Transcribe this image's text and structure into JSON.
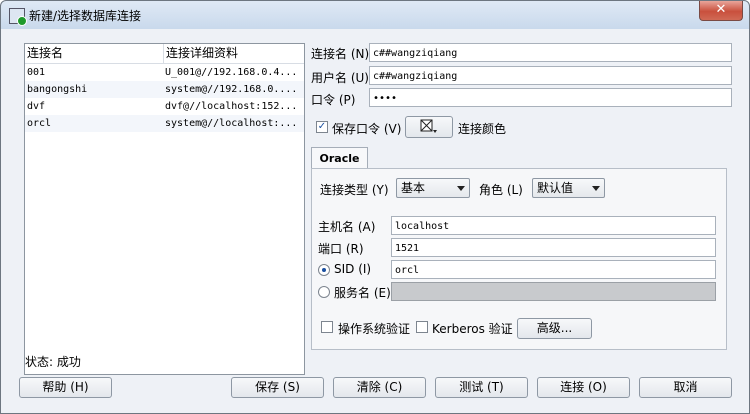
{
  "window": {
    "title": "新建/选择数据库连接",
    "close_glyph": "✕"
  },
  "list": {
    "headers": [
      "连接名",
      "连接详细资料"
    ],
    "rows": [
      {
        "name": "001",
        "detail": "U_001@//192.168.0.4..."
      },
      {
        "name": "bangongshi",
        "detail": "system@//192.168.0...."
      },
      {
        "name": "dvf",
        "detail": "dvf@//localhost:152..."
      },
      {
        "name": "orcl",
        "detail": "system@//localhost:..."
      }
    ]
  },
  "form": {
    "conn_name_label": "连接名 (N)",
    "conn_name_value": "c##wangziqiang",
    "user_label": "用户名 (U)",
    "user_value": "c##wangziqiang",
    "password_label": "口令 (P)",
    "password_value": "••••",
    "save_password_label": "保存口令 (V)",
    "save_password_checked": true,
    "color_label": "连接颜色",
    "tab_label": "Oracle",
    "conn_type_label": "连接类型 (Y)",
    "conn_type_value": "基本",
    "role_label": "角色 (L)",
    "role_value": "默认值",
    "host_label": "主机名 (A)",
    "host_value": "localhost",
    "port_label": "端口 (R)",
    "port_value": "1521",
    "sid_label": "SID (I)",
    "sid_value": "orcl",
    "service_label": "服务名 (E)",
    "os_auth_label": "操作系统验证",
    "kerberos_label": "Kerberos 验证",
    "advanced_label": "高级..."
  },
  "status": {
    "text": "状态: 成功"
  },
  "buttons": {
    "help": "帮助 (H)",
    "save": "保存 (S)",
    "clear": "清除 (C)",
    "test": "测试 (T)",
    "connect": "连接 (O)",
    "cancel": "取消"
  }
}
